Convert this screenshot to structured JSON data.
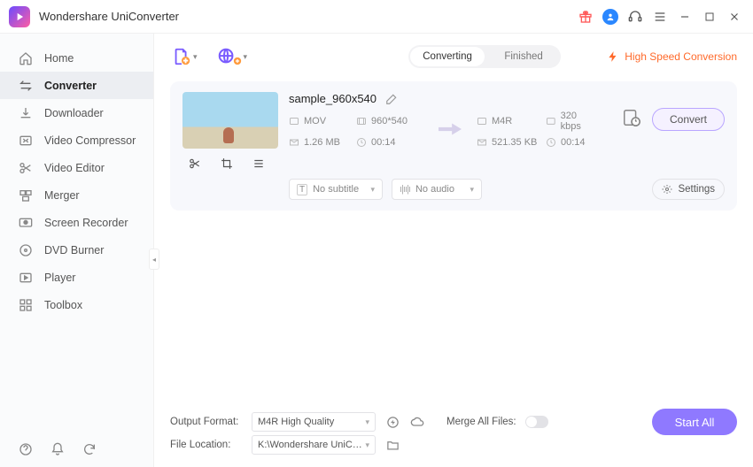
{
  "app": {
    "title": "Wondershare UniConverter"
  },
  "win_icons": {
    "gift": "gift-icon",
    "user": "user-icon",
    "support": "headset-icon",
    "menu": "menu-icon",
    "min": "minimize-icon",
    "max": "maximize-icon",
    "close": "close-icon"
  },
  "sidebar": {
    "items": [
      {
        "label": "Home",
        "icon": "home-icon"
      },
      {
        "label": "Converter",
        "icon": "converter-icon"
      },
      {
        "label": "Downloader",
        "icon": "download-icon"
      },
      {
        "label": "Video Compressor",
        "icon": "compress-icon"
      },
      {
        "label": "Video Editor",
        "icon": "scissors-icon"
      },
      {
        "label": "Merger",
        "icon": "merger-icon"
      },
      {
        "label": "Screen Recorder",
        "icon": "recorder-icon"
      },
      {
        "label": "DVD Burner",
        "icon": "disc-icon"
      },
      {
        "label": "Player",
        "icon": "play-icon"
      },
      {
        "label": "Toolbox",
        "icon": "grid-icon"
      }
    ],
    "active_index": 1,
    "footer_icons": {
      "help": "help-icon",
      "bell": "bell-icon",
      "update": "update-icon"
    }
  },
  "toolbar": {
    "tabs": {
      "converting": "Converting",
      "finished": "Finished"
    },
    "active_tab": "converting",
    "high_speed": "High Speed Conversion"
  },
  "file": {
    "name": "sample_960x540",
    "src": {
      "format": "MOV",
      "res": "960*540",
      "size": "1.26 MB",
      "dur": "00:14"
    },
    "dst": {
      "format": "M4R",
      "bitrate": "320 kbps",
      "size": "521.35 KB",
      "dur": "00:14"
    },
    "subtitle": "No subtitle",
    "audio": "No audio",
    "settings_label": "Settings",
    "convert_label": "Convert",
    "action_icons": {
      "cut": "cut-icon",
      "crop": "crop-icon",
      "more": "list-icon"
    }
  },
  "footer": {
    "output_format_label": "Output Format:",
    "output_format_value": "M4R High Quality",
    "file_location_label": "File Location:",
    "file_location_value": "K:\\Wondershare UniConverter",
    "merge_label": "Merge All Files:",
    "start_all": "Start All"
  }
}
